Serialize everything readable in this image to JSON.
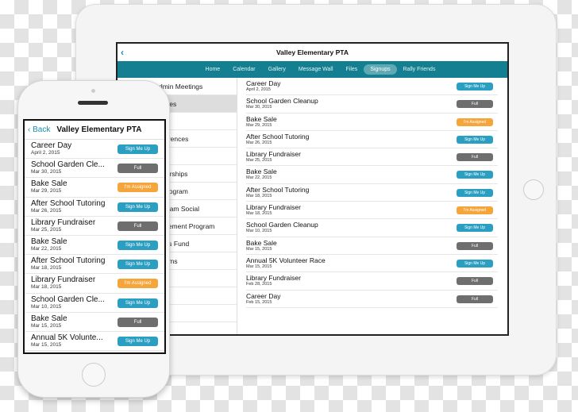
{
  "colors": {
    "teal_nav": "#137f90",
    "sign_up": "#2b9fc2",
    "full": "#6e6e6e",
    "assigned": "#f5a53a"
  },
  "status_labels": {
    "sign_up": "Sign Me Up",
    "full": "Full",
    "assigned": "I'm Assigned"
  },
  "tablet": {
    "back_icon": "chevron-left-icon",
    "back_glyph": "‹",
    "title": "Valley Elementary PTA",
    "nav": [
      "Home",
      "Calendar",
      "Gallery",
      "Message Wall",
      "Files",
      "Signups",
      "Rally Friends"
    ],
    "active_nav": "Signups",
    "left_items": [
      "dmin Meetings",
      "Dates",
      "ling",
      "nferences",
      "ngs",
      "nsorships",
      "l Program",
      "Cream Social",
      "rovement Program",
      "hers Fund",
      "grams",
      "",
      "",
      "",
      ""
    ],
    "selected_left": 1,
    "items": [
      {
        "title": "Career Day",
        "date": "April 2, 2015",
        "status": "Sign Me Up"
      },
      {
        "title": "School Garden Cleanup",
        "date": "Mar 30, 2015",
        "status": "Full"
      },
      {
        "title": "Bake Sale",
        "date": "Mar 29, 2015",
        "status": "I'm Assigned"
      },
      {
        "title": "After School Tutoring",
        "date": "Mar 26, 2015",
        "status": "Sign Me Up"
      },
      {
        "title": "Library Fundraiser",
        "date": "Mar 25, 2015",
        "status": "Full"
      },
      {
        "title": "Bake Sale",
        "date": "Mar 22, 2015",
        "status": "Sign Me Up"
      },
      {
        "title": "After School Tutoring",
        "date": "Mar 18, 2015",
        "status": "Sign Me Up"
      },
      {
        "title": "Library Fundraiser",
        "date": "Mar 18, 2015",
        "status": "I'm Assigned"
      },
      {
        "title": "School Garden Cleanup",
        "date": "Mar 10, 2015",
        "status": "Sign Me Up"
      },
      {
        "title": "Bake Sale",
        "date": "Mar 15, 2015",
        "status": "Full"
      },
      {
        "title": "Annual 5K Volunteer Race",
        "date": "Mar 15, 2015",
        "status": "Sign Me Up"
      },
      {
        "title": "Library Fundraiser",
        "date": "Feb 28, 2015",
        "status": "Full"
      },
      {
        "title": "Career Day",
        "date": "Feb 15, 2015",
        "status": "Full"
      }
    ]
  },
  "phone": {
    "back_label": "Back",
    "back_glyph": "‹",
    "title": "Valley Elementary PTA",
    "items": [
      {
        "title": "Career Day",
        "date": "April 2, 2015",
        "status": "Sign Me Up"
      },
      {
        "title": "School Garden Cle...",
        "date": "Mar 30, 2015",
        "status": "Full"
      },
      {
        "title": "Bake Sale",
        "date": "Mar 29, 2015",
        "status": "I'm Assigned"
      },
      {
        "title": "After School Tutoring",
        "date": "Mar 26, 2015",
        "status": "Sign Me Up"
      },
      {
        "title": "Library Fundraiser",
        "date": "Mar 25, 2015",
        "status": "Full"
      },
      {
        "title": "Bake Sale",
        "date": "Mar 22, 2015",
        "status": "Sign Me Up"
      },
      {
        "title": "After School Tutoring",
        "date": "Mar 18, 2015",
        "status": "Sign Me Up"
      },
      {
        "title": "Library Fundraiser",
        "date": "Mar 18, 2015",
        "status": "I'm Assigned"
      },
      {
        "title": "School Garden Cle...",
        "date": "Mar 10, 2015",
        "status": "Sign Me Up"
      },
      {
        "title": "Bake Sale",
        "date": "Mar 15, 2015",
        "status": "Full"
      },
      {
        "title": "Annual 5K Volunte...",
        "date": "Mar 15, 2015",
        "status": "Sign Me Up"
      }
    ]
  }
}
